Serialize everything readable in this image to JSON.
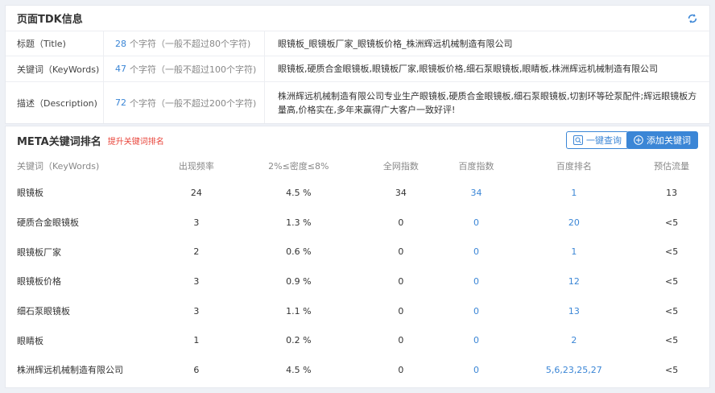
{
  "tdk": {
    "title": "页面TDK信息",
    "rows": [
      {
        "label": "标题（Title)",
        "count": "28",
        "count_suffix": "个字符（一般不超过80个字符)",
        "value": "眼镜板_眼镜板厂家_眼镜板价格_株洲辉远机械制造有限公司"
      },
      {
        "label": "关键词（KeyWords)",
        "count": "47",
        "count_suffix": "个字符（一般不超过100个字符)",
        "value": "眼镜板,硬质合金眼镜板,眼镜板厂家,眼镜板价格,细石泵眼镜板,眼睛板,株洲辉远机械制造有限公司"
      },
      {
        "label": "描述（Description)",
        "count": "72",
        "count_suffix": "个字符（一般不超过200个字符)",
        "value": "株洲辉远机械制造有限公司专业生产眼镜板,硬质合金眼镜板,细石泵眼镜板,切割环等砼泵配件;辉远眼镜板方量高,价格实在,多年来赢得广大客户一致好评!"
      }
    ]
  },
  "meta": {
    "title": "META关键词排名",
    "link": "提升关键词排名",
    "query_button": "一键查询",
    "add_button": "添加关键词",
    "columns": [
      "关键词（KeyWords)",
      "出现频率",
      "2%≤密度≤8%",
      "全网指数",
      "百度指数",
      "百度排名",
      "预估流量"
    ],
    "rows": [
      [
        "眼镜板",
        "24",
        "4.5 %",
        "34",
        "34",
        "1",
        "13"
      ],
      [
        "硬质合金眼镜板",
        "3",
        "1.3 %",
        "0",
        "0",
        "20",
        "<5"
      ],
      [
        "眼镜板厂家",
        "2",
        "0.6 %",
        "0",
        "0",
        "1",
        "<5"
      ],
      [
        "眼镜板价格",
        "3",
        "0.9 %",
        "0",
        "0",
        "12",
        "<5"
      ],
      [
        "细石泵眼镜板",
        "3",
        "1.1 %",
        "0",
        "0",
        "13",
        "<5"
      ],
      [
        "眼睛板",
        "1",
        "0.2 %",
        "0",
        "0",
        "2",
        "<5"
      ],
      [
        "株洲辉远机械制造有限公司",
        "6",
        "4.5 %",
        "0",
        "0",
        "5,6,23,25,27",
        "<5"
      ]
    ]
  },
  "colors": {
    "accent": "#3b86d6",
    "link_red": "#e8443a"
  }
}
